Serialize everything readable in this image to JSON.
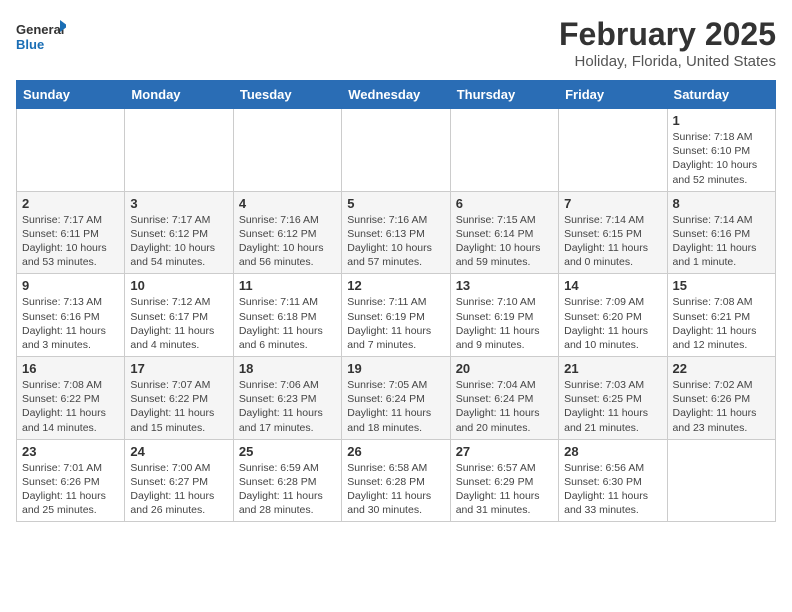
{
  "logo": {
    "general": "General",
    "blue": "Blue"
  },
  "header": {
    "title": "February 2025",
    "subtitle": "Holiday, Florida, United States"
  },
  "calendar": {
    "weekdays": [
      "Sunday",
      "Monday",
      "Tuesday",
      "Wednesday",
      "Thursday",
      "Friday",
      "Saturday"
    ],
    "rows": [
      [
        {
          "day": "",
          "info": ""
        },
        {
          "day": "",
          "info": ""
        },
        {
          "day": "",
          "info": ""
        },
        {
          "day": "",
          "info": ""
        },
        {
          "day": "",
          "info": ""
        },
        {
          "day": "",
          "info": ""
        },
        {
          "day": "1",
          "info": "Sunrise: 7:18 AM\nSunset: 6:10 PM\nDaylight: 10 hours\nand 52 minutes."
        }
      ],
      [
        {
          "day": "2",
          "info": "Sunrise: 7:17 AM\nSunset: 6:11 PM\nDaylight: 10 hours\nand 53 minutes."
        },
        {
          "day": "3",
          "info": "Sunrise: 7:17 AM\nSunset: 6:12 PM\nDaylight: 10 hours\nand 54 minutes."
        },
        {
          "day": "4",
          "info": "Sunrise: 7:16 AM\nSunset: 6:12 PM\nDaylight: 10 hours\nand 56 minutes."
        },
        {
          "day": "5",
          "info": "Sunrise: 7:16 AM\nSunset: 6:13 PM\nDaylight: 10 hours\nand 57 minutes."
        },
        {
          "day": "6",
          "info": "Sunrise: 7:15 AM\nSunset: 6:14 PM\nDaylight: 10 hours\nand 59 minutes."
        },
        {
          "day": "7",
          "info": "Sunrise: 7:14 AM\nSunset: 6:15 PM\nDaylight: 11 hours\nand 0 minutes."
        },
        {
          "day": "8",
          "info": "Sunrise: 7:14 AM\nSunset: 6:16 PM\nDaylight: 11 hours\nand 1 minute."
        }
      ],
      [
        {
          "day": "9",
          "info": "Sunrise: 7:13 AM\nSunset: 6:16 PM\nDaylight: 11 hours\nand 3 minutes."
        },
        {
          "day": "10",
          "info": "Sunrise: 7:12 AM\nSunset: 6:17 PM\nDaylight: 11 hours\nand 4 minutes."
        },
        {
          "day": "11",
          "info": "Sunrise: 7:11 AM\nSunset: 6:18 PM\nDaylight: 11 hours\nand 6 minutes."
        },
        {
          "day": "12",
          "info": "Sunrise: 7:11 AM\nSunset: 6:19 PM\nDaylight: 11 hours\nand 7 minutes."
        },
        {
          "day": "13",
          "info": "Sunrise: 7:10 AM\nSunset: 6:19 PM\nDaylight: 11 hours\nand 9 minutes."
        },
        {
          "day": "14",
          "info": "Sunrise: 7:09 AM\nSunset: 6:20 PM\nDaylight: 11 hours\nand 10 minutes."
        },
        {
          "day": "15",
          "info": "Sunrise: 7:08 AM\nSunset: 6:21 PM\nDaylight: 11 hours\nand 12 minutes."
        }
      ],
      [
        {
          "day": "16",
          "info": "Sunrise: 7:08 AM\nSunset: 6:22 PM\nDaylight: 11 hours\nand 14 minutes."
        },
        {
          "day": "17",
          "info": "Sunrise: 7:07 AM\nSunset: 6:22 PM\nDaylight: 11 hours\nand 15 minutes."
        },
        {
          "day": "18",
          "info": "Sunrise: 7:06 AM\nSunset: 6:23 PM\nDaylight: 11 hours\nand 17 minutes."
        },
        {
          "day": "19",
          "info": "Sunrise: 7:05 AM\nSunset: 6:24 PM\nDaylight: 11 hours\nand 18 minutes."
        },
        {
          "day": "20",
          "info": "Sunrise: 7:04 AM\nSunset: 6:24 PM\nDaylight: 11 hours\nand 20 minutes."
        },
        {
          "day": "21",
          "info": "Sunrise: 7:03 AM\nSunset: 6:25 PM\nDaylight: 11 hours\nand 21 minutes."
        },
        {
          "day": "22",
          "info": "Sunrise: 7:02 AM\nSunset: 6:26 PM\nDaylight: 11 hours\nand 23 minutes."
        }
      ],
      [
        {
          "day": "23",
          "info": "Sunrise: 7:01 AM\nSunset: 6:26 PM\nDaylight: 11 hours\nand 25 minutes."
        },
        {
          "day": "24",
          "info": "Sunrise: 7:00 AM\nSunset: 6:27 PM\nDaylight: 11 hours\nand 26 minutes."
        },
        {
          "day": "25",
          "info": "Sunrise: 6:59 AM\nSunset: 6:28 PM\nDaylight: 11 hours\nand 28 minutes."
        },
        {
          "day": "26",
          "info": "Sunrise: 6:58 AM\nSunset: 6:28 PM\nDaylight: 11 hours\nand 30 minutes."
        },
        {
          "day": "27",
          "info": "Sunrise: 6:57 AM\nSunset: 6:29 PM\nDaylight: 11 hours\nand 31 minutes."
        },
        {
          "day": "28",
          "info": "Sunrise: 6:56 AM\nSunset: 6:30 PM\nDaylight: 11 hours\nand 33 minutes."
        },
        {
          "day": "",
          "info": ""
        }
      ]
    ]
  }
}
